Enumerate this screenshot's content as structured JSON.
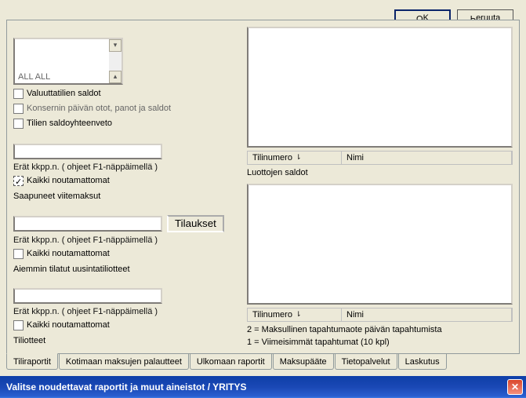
{
  "window": {
    "title": "Valitse noudettavat raportit ja muut aineistot / YRITYS"
  },
  "tabs": [
    {
      "label": "Tiliraportit",
      "active": true
    },
    {
      "label": "Kotimaan maksujen palautteet"
    },
    {
      "label": "Ulkomaan raportit"
    },
    {
      "label": "Maksupääte"
    },
    {
      "label": "Tietopalvelut"
    },
    {
      "label": "Laskutus"
    }
  ],
  "left": {
    "sec1": {
      "title": "Tiliotteet",
      "chk": "Kaikki noutamattomat",
      "note": "Erät kkpp.n. ( ohjeet F1-näppäimellä )"
    },
    "sec2": {
      "title": "Aiemmin tilatut uusintatiliotteet",
      "chk": "Kaikki noutamattomat",
      "note": "Erät kkpp.n. ( ohjeet F1-näppäimellä )",
      "btn": "Tilaukset"
    },
    "sec3": {
      "title": "Saapuneet viitemaksut",
      "chk": "Kaikki noutamattomat",
      "note": "Erät kkpp.n. ( ohjeet F1-näppäimellä )"
    },
    "sec4": {
      "chk1": "Tilien saldoyhteenveto",
      "chk2": "Konsernin päivän otot, panot ja saldot",
      "chk3": "Valuuttatilien saldot",
      "list_item": "ALL ALL"
    }
  },
  "right": {
    "note1": "1 = Viimeisimmät tapahtumat (10 kpl)",
    "note2": "2 = Maksullinen tapahtumaote päivän tapahtumista",
    "cols": {
      "c1": "Tilinumero",
      "c2": "Nimi"
    },
    "sort": "⇂",
    "section2": "Luottojen saldot"
  },
  "buttons": {
    "ok": "OK",
    "cancel": "Peruuta"
  }
}
